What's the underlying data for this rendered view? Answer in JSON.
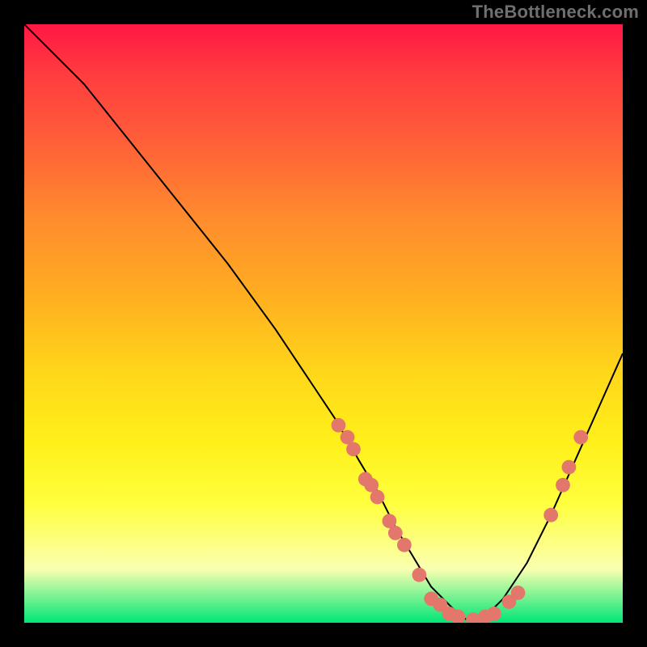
{
  "watermark": "TheBottleneck.com",
  "chart_data": {
    "type": "line",
    "title": "",
    "xlabel": "",
    "ylabel": "",
    "xlim": [
      0,
      100
    ],
    "ylim": [
      0,
      100
    ],
    "grid": false,
    "legend": false,
    "series": [
      {
        "name": "curve",
        "x": [
          0,
          4,
          10,
          18,
          26,
          34,
          42,
          48,
          52,
          56,
          59,
          62,
          65,
          68,
          71,
          73,
          75,
          77,
          80,
          84,
          88,
          92,
          96,
          100
        ],
        "y": [
          100,
          96,
          90,
          80,
          70,
          60,
          49,
          40,
          34,
          27,
          22,
          16,
          11,
          6,
          3,
          1,
          0,
          1,
          4,
          10,
          18,
          27,
          36,
          45
        ]
      }
    ],
    "markers": [
      {
        "x": 52.5,
        "y": 33
      },
      {
        "x": 54,
        "y": 31
      },
      {
        "x": 55,
        "y": 29
      },
      {
        "x": 57,
        "y": 24
      },
      {
        "x": 58,
        "y": 23
      },
      {
        "x": 59,
        "y": 21
      },
      {
        "x": 61,
        "y": 17
      },
      {
        "x": 62,
        "y": 15
      },
      {
        "x": 63.5,
        "y": 13
      },
      {
        "x": 66,
        "y": 8
      },
      {
        "x": 68,
        "y": 4
      },
      {
        "x": 69.5,
        "y": 3
      },
      {
        "x": 71,
        "y": 1.5
      },
      {
        "x": 72.5,
        "y": 1
      },
      {
        "x": 75,
        "y": 0.5
      },
      {
        "x": 77,
        "y": 1
      },
      {
        "x": 78.5,
        "y": 1.5
      },
      {
        "x": 81,
        "y": 3.5
      },
      {
        "x": 82.5,
        "y": 5
      },
      {
        "x": 88,
        "y": 18
      },
      {
        "x": 90,
        "y": 23
      },
      {
        "x": 91,
        "y": 26
      },
      {
        "x": 93,
        "y": 31
      }
    ],
    "background_gradient": {
      "stops": [
        {
          "pos": 0,
          "color": "#ff1744"
        },
        {
          "pos": 8,
          "color": "#ff3b3f"
        },
        {
          "pos": 18,
          "color": "#ff5a3a"
        },
        {
          "pos": 32,
          "color": "#ff8a2e"
        },
        {
          "pos": 46,
          "color": "#ffb020"
        },
        {
          "pos": 58,
          "color": "#ffd61a"
        },
        {
          "pos": 70,
          "color": "#fff01a"
        },
        {
          "pos": 80,
          "color": "#ffff3d"
        },
        {
          "pos": 91,
          "color": "#faffb0"
        },
        {
          "pos": 100,
          "color": "#00e676"
        }
      ]
    },
    "marker_color": "#e3776c",
    "line_color": "#000000"
  }
}
